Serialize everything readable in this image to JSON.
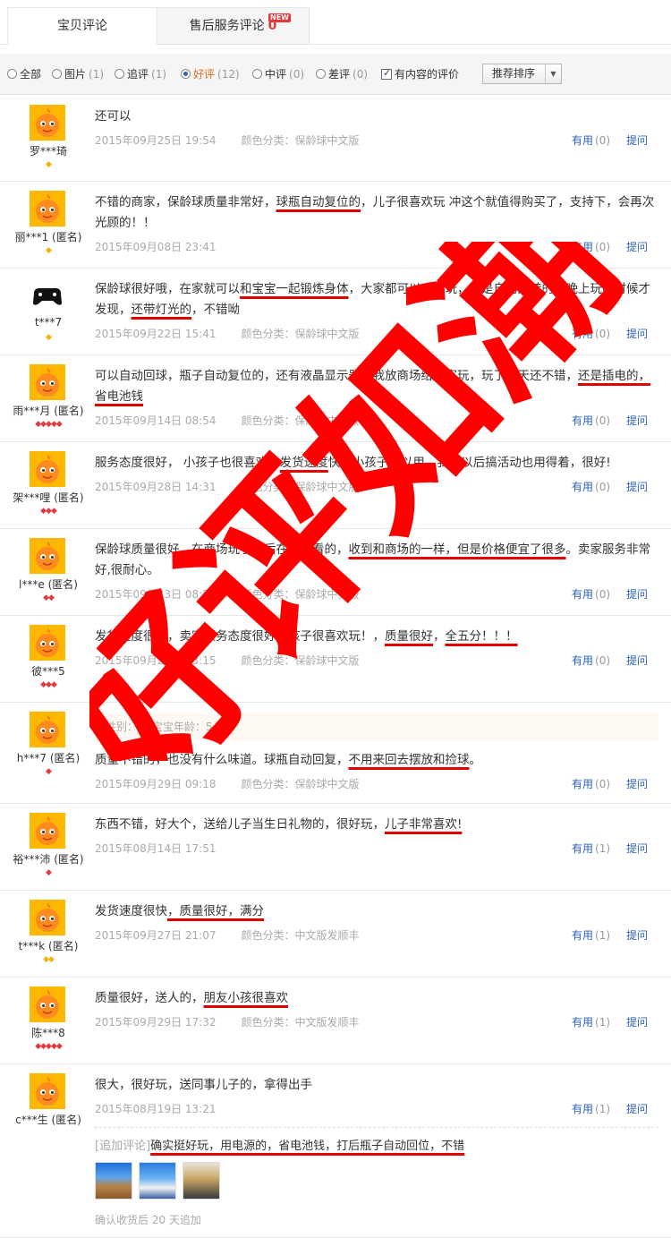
{
  "tabs": [
    {
      "label": "宝贝评论"
    },
    {
      "label": "售后服务评论",
      "count": "0",
      "badge": "NEW"
    }
  ],
  "filters": [
    {
      "label": "全部",
      "count": "",
      "selected": false
    },
    {
      "label": "图片",
      "count": "(1)",
      "selected": false
    },
    {
      "label": "追评",
      "count": "(1)",
      "selected": false
    },
    {
      "label": "好评",
      "count": "(12)",
      "selected": true
    },
    {
      "label": "中评",
      "count": "(0)",
      "selected": false
    },
    {
      "label": "差评",
      "count": "(0)",
      "selected": false
    }
  ],
  "content_only": {
    "label": "有内容的评价",
    "checked": true
  },
  "sort": {
    "label": "推荐排序"
  },
  "actions": {
    "useful": "有用",
    "reply": "提问"
  },
  "reviews": [
    {
      "user": "罗***琦",
      "badge": "◆",
      "text": "还可以",
      "date": "2015年09月25日 19:54",
      "sku": "颜色分类：保龄球中文版",
      "useful_count": "(0)"
    },
    {
      "user": "丽***1 (匿名)",
      "badge": "◆",
      "text_parts": [
        "不错的商家，保龄球质量非常好，",
        "球瓶自动复位的",
        "，儿子很喜欢玩 冲这个就值得购买了，支持下，会再次光顾的！！"
      ],
      "date": "2015年09月08日 23:41",
      "sku": "",
      "useful_count": "(0)"
    },
    {
      "user": "t***7",
      "badge": "◆",
      "text_parts": [
        "保龄球很好哦，在家就可以",
        "和宝宝一起锻炼身体",
        "，大家都可以一起玩，就是自动回转的，晚上玩的时候才发现，",
        "还带灯光的",
        "，不错呦"
      ],
      "date": "2015年09月22日 15:41",
      "sku": "颜色分类：保龄球中文版",
      "useful_count": "(0)"
    },
    {
      "user": "雨***月 (匿名)",
      "badge": "◆◆◆◆◆",
      "text_parts": [
        "可以自动回球，瓶子自动复位的，还有液晶显示器，我放商场给顾客玩，玩了几天还不错，",
        "还是插电的，省电池钱"
      ],
      "date": "2015年09月14日 08:54",
      "sku": "颜色分类：保龄球中文版",
      "useful_count": "(0)"
    },
    {
      "user": "架***哩 (匿名)",
      "badge": "◆◆◆",
      "text_parts": [
        "服务态度很好， 小孩子也很喜欢，",
        "发货速度",
        "快，小孩子可以用，我们以后搞活动也用得着，很好!"
      ],
      "date": "2015年09月28日 14:31",
      "sku": "颜色分类：保龄球中文版",
      "useful_count": "(0)"
    },
    {
      "user": "l***e (匿名)",
      "badge": "◆◆",
      "text_parts": [
        "保龄球质量很好，在商场玩了之后在网上看的，",
        "收到和商场的一样，但是价格便宜了很多",
        "。卖家服务非常好,很耐心。"
      ],
      "date": "2015年09月23日 08:55",
      "sku": "颜色分类：保龄球中文版",
      "useful_count": "(0)"
    },
    {
      "user": "彼***5",
      "badge": "◆◆◆",
      "text_parts": [
        "发货速度很快，卖家服务态度很好，孩子很喜欢玩！，",
        "质量很好",
        "，",
        "全五分！！！"
      ],
      "date": "2015年09月27日 13:15",
      "sku": "颜色分类：保龄球中文版",
      "useful_count": "(0)"
    },
    {
      "user": "h***7 (匿名)",
      "badge": "◆",
      "attr": "性别：男    宝宝年龄：5",
      "text_parts": [
        "质量不错的，也没有什么味道。球瓶自动回复，",
        "不用来回去摆放和捡球",
        "。"
      ],
      "date": "2015年09月29日 09:18",
      "sku": "颜色分类：保龄球中文版",
      "useful_count": "(0)"
    },
    {
      "user": "裕***沛 (匿名)",
      "badge": "◆",
      "text_parts": [
        "东西不错，好大个，送给儿子当生日礼物的，很好玩，",
        "儿子非常喜欢!"
      ],
      "date": "2015年08月14日 17:51",
      "sku": "",
      "useful_count": "(1)"
    },
    {
      "user": "t***k (匿名)",
      "badge": "◆◆",
      "text_parts": [
        "发货速度很快",
        "，质量很好，满分"
      ],
      "date": "2015年09月27日 21:07",
      "sku": "颜色分类：中文版发顺丰",
      "useful_count": "(1)"
    },
    {
      "user": "陈***8",
      "badge": "◆◆◆◆◆",
      "text_parts": [
        "质量很好，送人的，",
        "朋友小孩很喜欢"
      ],
      "date": "2015年09月29日 17:32",
      "sku": "颜色分类：中文版发顺丰",
      "useful_count": "(1)"
    },
    {
      "user": "c***生 (匿名)",
      "badge": "",
      "text": "很大，很好玩，送同事儿子的，拿得出手",
      "date": "2015年08月19日 13:21",
      "sku": "",
      "useful_count": "(1)",
      "append_tag": "[追加评论]",
      "append_text": "确实挺好玩，用电源的，省电池钱，打后瓶子自动回位，不错",
      "append_note": "确认收货后 20 天追加"
    }
  ],
  "watermark": {
    "text": "好评如潮",
    "color": "#ff0000"
  },
  "colors": {
    "link": "#2a62b8",
    "accent": "#e4393c",
    "muted": "#aaaaaa",
    "underline": "#e30000"
  }
}
